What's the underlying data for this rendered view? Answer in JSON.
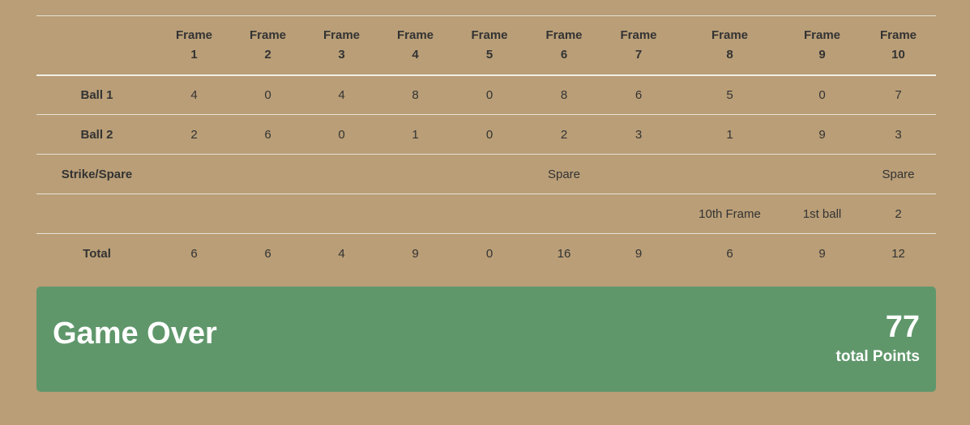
{
  "scorecard": {
    "frames": [
      {
        "label": "Frame",
        "num": "1"
      },
      {
        "label": "Frame",
        "num": "2"
      },
      {
        "label": "Frame",
        "num": "3"
      },
      {
        "label": "Frame",
        "num": "4"
      },
      {
        "label": "Frame",
        "num": "5"
      },
      {
        "label": "Frame",
        "num": "6"
      },
      {
        "label": "Frame",
        "num": "7"
      },
      {
        "label": "Frame",
        "num": "8"
      },
      {
        "label": "Frame",
        "num": "9"
      },
      {
        "label": "Frame",
        "num": "10"
      }
    ],
    "rows": [
      {
        "name": "ball-1-row",
        "label": "Ball 1",
        "cells": [
          "4",
          "0",
          "4",
          "8",
          "0",
          "8",
          "6",
          "5",
          "0",
          "7"
        ]
      },
      {
        "name": "ball-2-row",
        "label": "Ball 2",
        "cells": [
          "2",
          "6",
          "0",
          "1",
          "0",
          "2",
          "3",
          "1",
          "9",
          "3"
        ]
      },
      {
        "name": "strike-spare-row",
        "label": "Strike/Spare",
        "cells": [
          "",
          "",
          "",
          "",
          "",
          "Spare",
          "",
          "",
          "",
          "Spare"
        ]
      },
      {
        "name": "tenth-frame-bonus-row",
        "label": "",
        "cells": [
          "",
          "",
          "",
          "",
          "",
          "",
          "",
          "10th Frame",
          "1st ball",
          "2"
        ]
      },
      {
        "name": "total-row",
        "label": "Total",
        "cells": [
          "6",
          "6",
          "4",
          "9",
          "0",
          "16",
          "9",
          "6",
          "9",
          "12"
        ]
      }
    ]
  },
  "result": {
    "title": "Game Over",
    "total_points": "77",
    "points_caption": "total Points"
  },
  "colors": {
    "page_background": "#b99e77",
    "result_panel": "#5f976b",
    "text": "#333333",
    "rule_lines": "#e7e2d6"
  }
}
